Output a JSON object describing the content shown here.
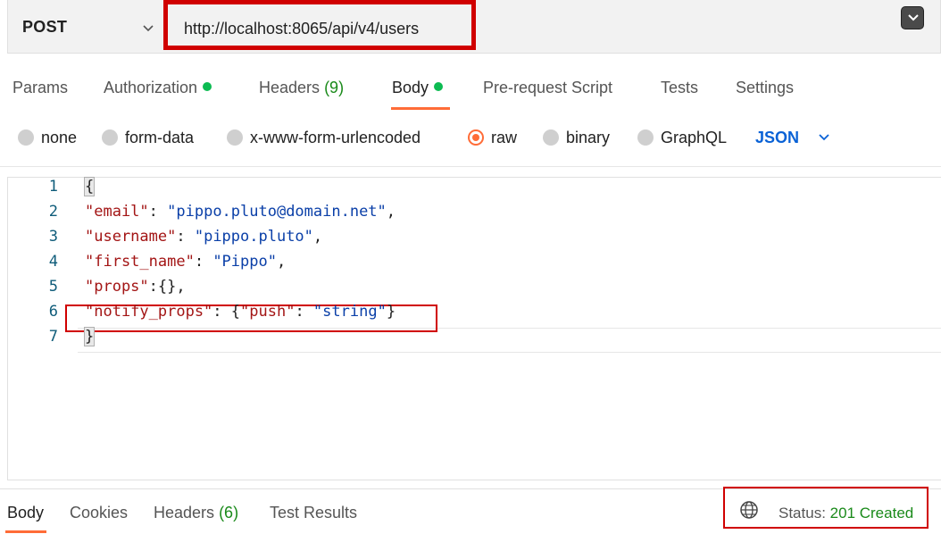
{
  "request": {
    "method": "POST",
    "url": "http://localhost:8065/api/v4/users"
  },
  "tabs": [
    {
      "label": "Params"
    },
    {
      "label": "Authorization"
    },
    {
      "label": "Headers",
      "count": "(9)"
    },
    {
      "label": "Body"
    },
    {
      "label": "Pre-request Script"
    },
    {
      "label": "Tests"
    },
    {
      "label": "Settings"
    }
  ],
  "body_types": [
    "none",
    "form-data",
    "x-www-form-urlencoded",
    "raw",
    "binary",
    "GraphQL"
  ],
  "selected_body_type": "raw",
  "format": "JSON",
  "editor": {
    "line_numbers": [
      "1",
      "2",
      "3",
      "4",
      "5",
      "6",
      "7"
    ],
    "lines": [
      [
        {
          "t": "p",
          "v": "{"
        }
      ],
      [
        {
          "t": "k",
          "v": "\"email\""
        },
        {
          "t": "p",
          "v": ": "
        },
        {
          "t": "s",
          "v": "\"pippo.pluto@domain.net\""
        },
        {
          "t": "p",
          "v": ","
        }
      ],
      [
        {
          "t": "k",
          "v": "\"username\""
        },
        {
          "t": "p",
          "v": ": "
        },
        {
          "t": "s",
          "v": "\"pippo.pluto\""
        },
        {
          "t": "p",
          "v": ","
        }
      ],
      [
        {
          "t": "k",
          "v": "\"first_name\""
        },
        {
          "t": "p",
          "v": ": "
        },
        {
          "t": "s",
          "v": "\"Pippo\""
        },
        {
          "t": "p",
          "v": ","
        }
      ],
      [
        {
          "t": "k",
          "v": "\"props\""
        },
        {
          "t": "p",
          "v": ":{},"
        }
      ],
      [
        {
          "t": "k",
          "v": "\"notify_props\""
        },
        {
          "t": "p",
          "v": ": {"
        },
        {
          "t": "k",
          "v": "\"push\""
        },
        {
          "t": "p",
          "v": ": "
        },
        {
          "t": "s",
          "v": "\"string\""
        },
        {
          "t": "p",
          "v": "}"
        }
      ],
      [
        {
          "t": "p",
          "v": "}"
        }
      ]
    ]
  },
  "response": {
    "tabs": [
      {
        "label": "Body"
      },
      {
        "label": "Cookies"
      },
      {
        "label": "Headers",
        "count": "(6)"
      },
      {
        "label": "Test Results"
      }
    ],
    "status_label": "Status:",
    "status_value": "201 Created"
  },
  "colors": {
    "accent": "#ff6c37",
    "highlight_box": "#d00000",
    "status_ok": "#1a8a1a",
    "json_key": "#a31515",
    "json_string": "#0a3fa8",
    "format_link": "#0a62d6"
  }
}
